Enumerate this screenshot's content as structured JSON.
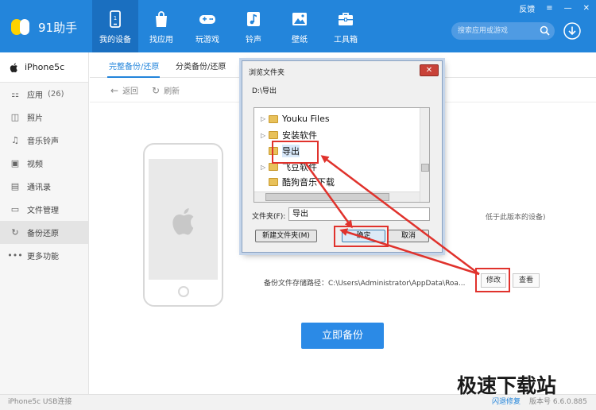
{
  "app": {
    "brand": "91助手",
    "nav": [
      {
        "label": "我的设备",
        "icon": "phone-icon"
      },
      {
        "label": "找应用",
        "icon": "shopping-bag-icon"
      },
      {
        "label": "玩游戏",
        "icon": "gamepad-icon"
      },
      {
        "label": "铃声",
        "icon": "music-note-icon"
      },
      {
        "label": "壁纸",
        "icon": "picture-icon"
      },
      {
        "label": "工具箱",
        "icon": "toolbox-icon"
      }
    ],
    "window_controls": {
      "feedback": "反馈",
      "menu": "≡",
      "minimize": "—",
      "close": "✕"
    },
    "search": {
      "placeholder": "搜索应用或游戏"
    }
  },
  "sidebar": {
    "device": "iPhone5c",
    "items": [
      {
        "label": "应用",
        "count": "(26)",
        "icon": "apps-icon"
      },
      {
        "label": "照片",
        "icon": "camera-icon"
      },
      {
        "label": "音乐铃声",
        "icon": "music-icon"
      },
      {
        "label": "视频",
        "icon": "video-icon"
      },
      {
        "label": "通讯录",
        "icon": "contacts-icon"
      },
      {
        "label": "文件管理",
        "icon": "folder-icon"
      },
      {
        "label": "备份还原",
        "icon": "backup-icon"
      },
      {
        "label": "更多功能",
        "icon": "more-icon"
      }
    ]
  },
  "main": {
    "tabs": [
      {
        "label": "完整备份/还原"
      },
      {
        "label": "分类备份/还原"
      }
    ],
    "toolbar": {
      "back": "返回",
      "refresh": "刷新"
    },
    "hint": "低于此版本的设备)",
    "path_label": "备份文件存储路径：C:\\Users\\Administrator\\AppData\\Roa...",
    "modify_button": "修改",
    "view_button": "查看",
    "backup_button": "立即备份"
  },
  "dialog": {
    "title": "浏览文件夹",
    "close": "✕",
    "path": "D:\\导出",
    "tree": [
      {
        "label": "Youku Files",
        "expandable": true
      },
      {
        "label": "安装软件",
        "expandable": true
      },
      {
        "label": "导出",
        "expandable": false,
        "selected": true
      },
      {
        "label": "飞豆软件",
        "expandable": true
      },
      {
        "label": "酷狗音乐下载",
        "expandable": false
      }
    ],
    "folder_label": "文件夹(F):",
    "folder_value": "导出",
    "new_folder_button": "新建文件夹(M)",
    "ok_button": "确定",
    "cancel_button": "取消"
  },
  "statusbar": {
    "connection": "iPhone5c  USB连接",
    "fix": "闪退修复",
    "version": "版本号 6.6.0.885"
  },
  "watermark": "极速下载站",
  "colors": {
    "primary": "#2385db",
    "highlight": "#e0322c"
  }
}
